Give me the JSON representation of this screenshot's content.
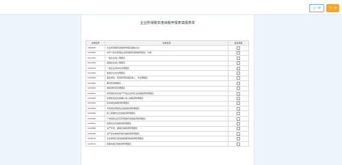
{
  "toolbar": {
    "prev_label": "上一步",
    "next_label": "下一步"
  },
  "page": {
    "title": "企业所得税年度纳税申报表填报表单"
  },
  "table": {
    "headers": [
      "表单编号",
      "表单名称",
      "是否填报"
    ],
    "rows": [
      {
        "code": "A000000",
        "name": "企业所得税年度纳税申报基础信息表"
      },
      {
        "code": "A100000",
        "name": "中华人民共和国企业所得税年度纳税申报表（A类）"
      },
      {
        "code": "A101010",
        "name": "一般企业收入明细表"
      },
      {
        "code": "A101020",
        "name": "金融企业收入明细表"
      },
      {
        "code": "A102010",
        "name": "一般企业成本支出明细表"
      },
      {
        "code": "A102020",
        "name": "金融企业支出明细表"
      },
      {
        "code": "A103000",
        "name": "事业单位、民间非营利组织收入、支出明细表"
      },
      {
        "code": "A104000",
        "name": "期间费用明细表"
      },
      {
        "code": "A105000",
        "name": "纳税调整项目明细表"
      },
      {
        "code": "A105010",
        "name": "视同销售和房地产开发企业特定业务纳税调整明细表"
      },
      {
        "code": "A105020",
        "name": "未按权责发生制确认收入纳税调整明细表"
      },
      {
        "code": "A105030",
        "name": "投资收益纳税调整明细表"
      },
      {
        "code": "A105040",
        "name": "专项用途财政性资金纳税调整明细表"
      },
      {
        "code": "A105050",
        "name": "职工薪酬支出及纳税调整明细表"
      },
      {
        "code": "A105060",
        "name": "广告费和业务宣传费跨年度纳税调整明细表"
      },
      {
        "code": "A105070",
        "name": "捐赠支出及纳税调整明细表"
      },
      {
        "code": "A105080",
        "name": "资产折旧、摊销及纳税调整明细表"
      },
      {
        "code": "A105090",
        "name": "资产损失税前扣除及纳税调整明细表"
      },
      {
        "code": "A105100",
        "name": "企业重组及递延纳税事项纳税调整明细表"
      },
      {
        "code": "A105110",
        "name": "政策性搬迁纳税调整明细表"
      }
    ]
  }
}
